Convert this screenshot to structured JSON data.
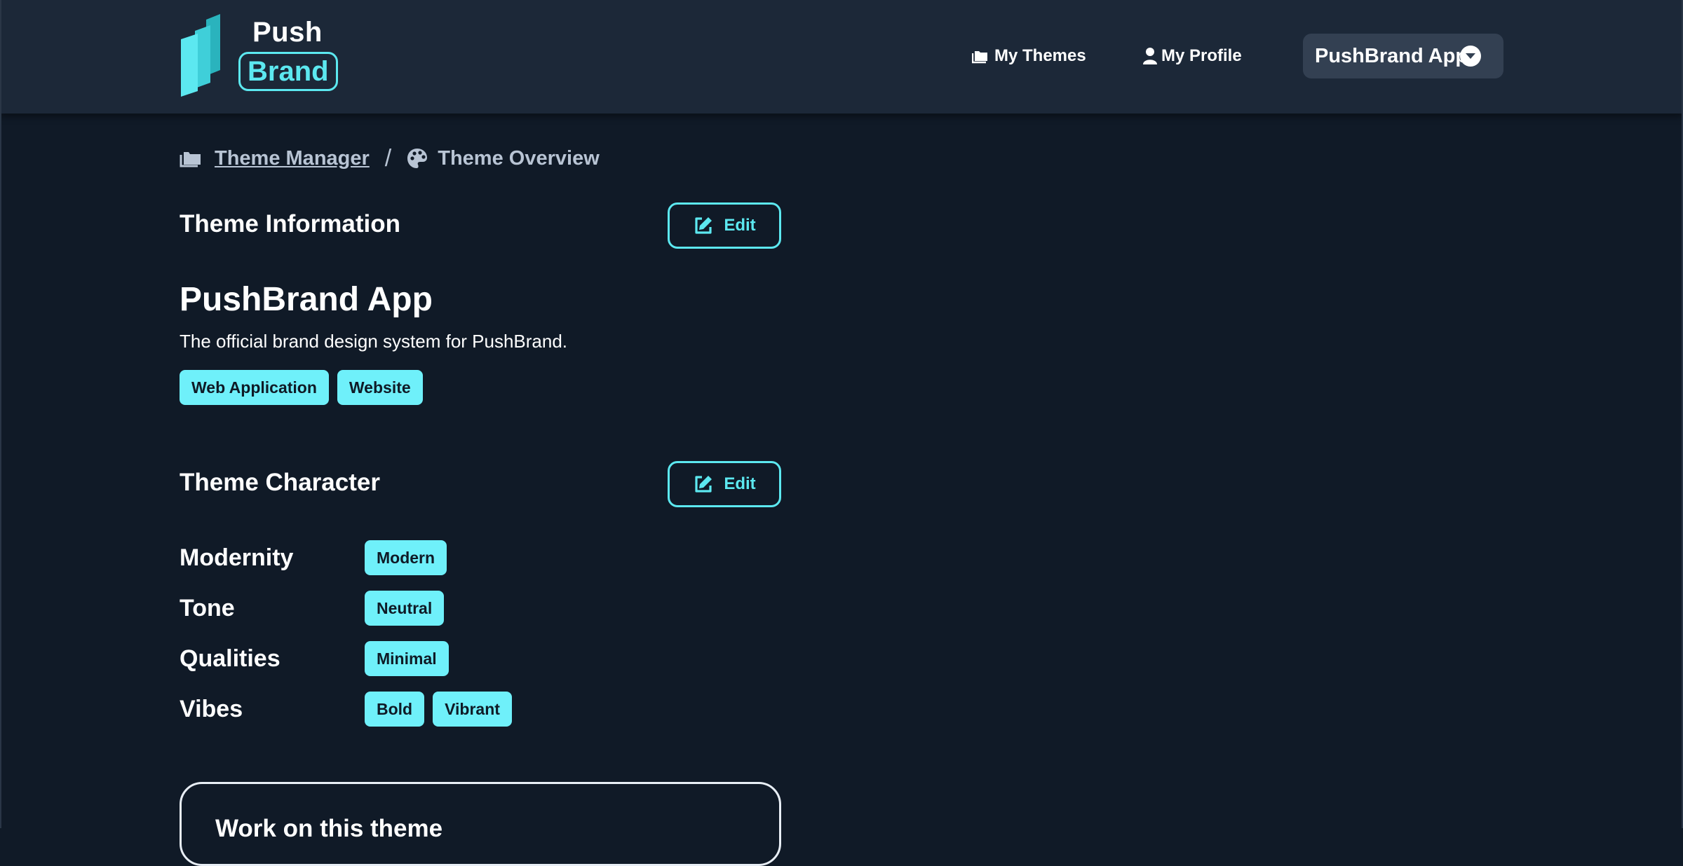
{
  "header": {
    "logo": {
      "word_top": "Push",
      "word_bottom": "Brand"
    },
    "nav": {
      "my_themes": "My Themes",
      "my_profile": "My Profile"
    },
    "app_select": {
      "value": "PushBrand App"
    }
  },
  "breadcrumb": {
    "parent": "Theme Manager",
    "separator": "/",
    "current": "Theme Overview"
  },
  "theme_information": {
    "title": "Theme Information",
    "edit_label": "Edit",
    "name": "PushBrand App",
    "description": "The official brand design system for PushBrand.",
    "tags": [
      "Web Application",
      "Website"
    ]
  },
  "theme_character": {
    "title": "Theme Character",
    "edit_label": "Edit",
    "rows": [
      {
        "label": "Modernity",
        "tags": [
          "Modern"
        ]
      },
      {
        "label": "Tone",
        "tags": [
          "Neutral"
        ]
      },
      {
        "label": "Qualities",
        "tags": [
          "Minimal"
        ]
      },
      {
        "label": "Vibes",
        "tags": [
          "Bold",
          "Vibrant"
        ]
      }
    ]
  },
  "work_card": {
    "title": "Work on this theme"
  },
  "colors": {
    "background": "#101a27",
    "header": "#1c2838",
    "accent": "#5ce8f0",
    "tag_fill": "#6ff0fa",
    "select_fill": "#334052"
  },
  "icons": {
    "themes": "folder-icon",
    "profile": "user-icon",
    "dropdown": "chevron-down-icon",
    "breadcrumb_parent": "folder-icon",
    "breadcrumb_current": "palette-icon",
    "edit": "edit-icon"
  }
}
